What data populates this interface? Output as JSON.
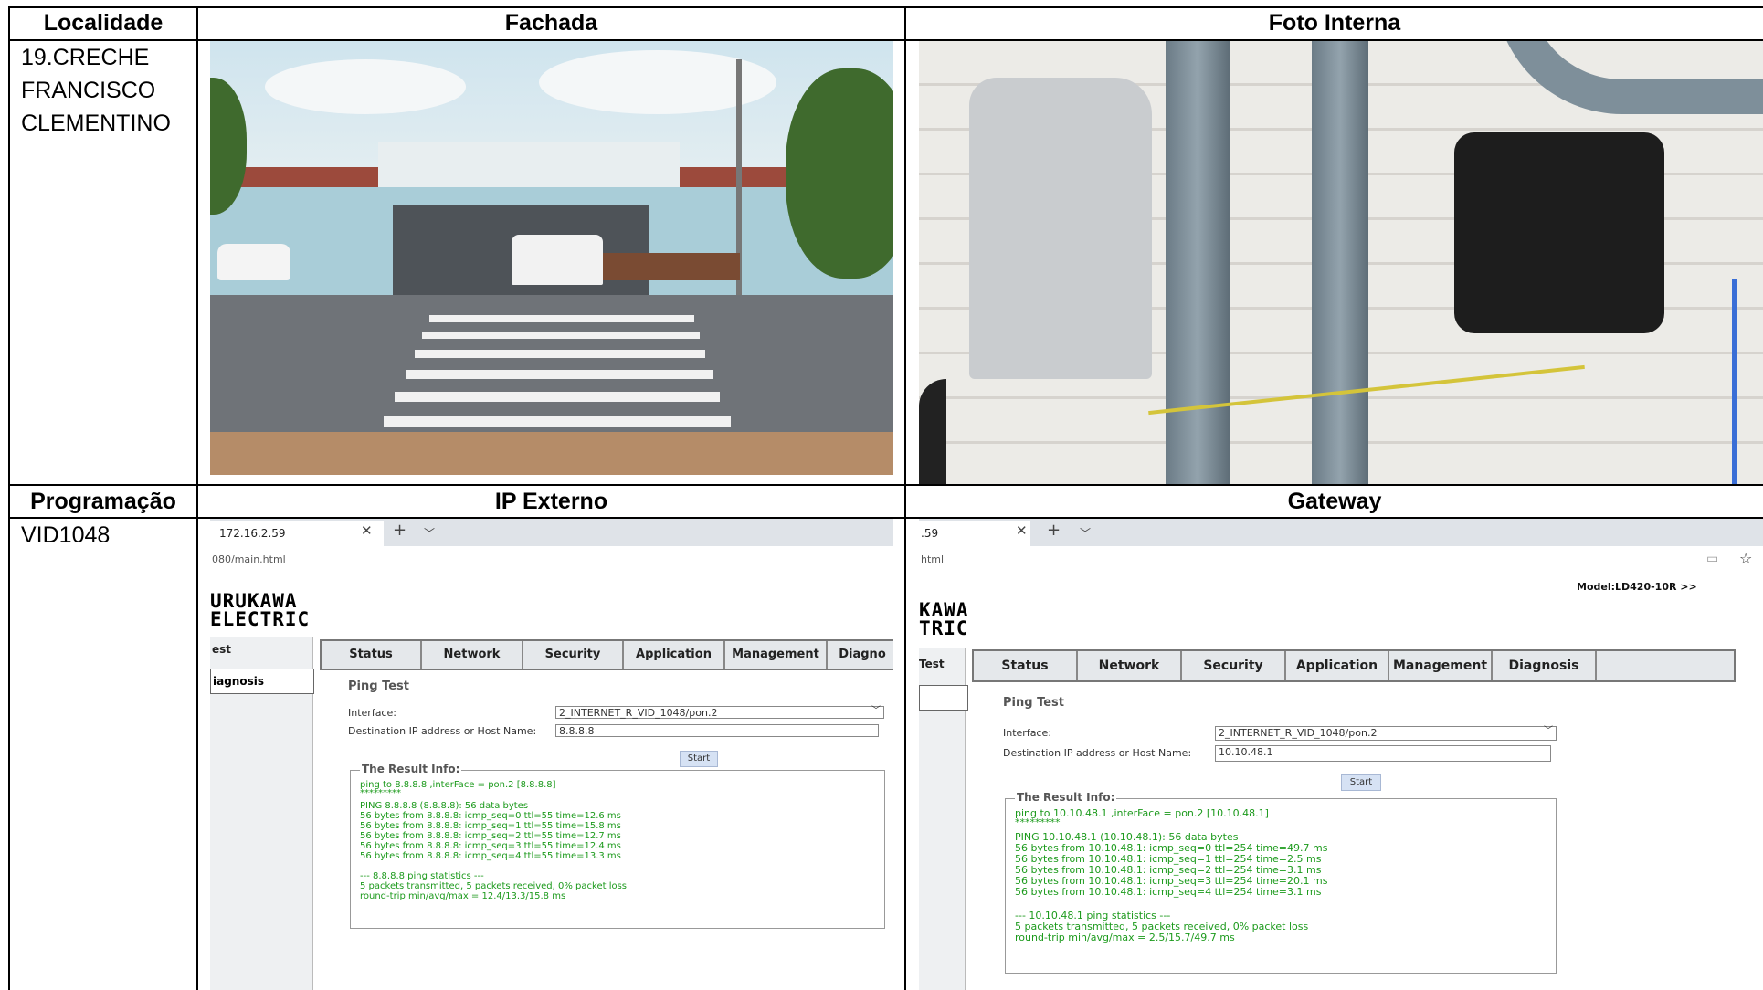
{
  "table": {
    "headers": {
      "localidade": "Localidade",
      "fachada": "Fachada",
      "foto_interna": "Foto Interna",
      "programacao": "Programação",
      "ip_externo": "IP Externo",
      "gateway": "Gateway"
    },
    "localidade_value": [
      "19.CRECHE",
      "FRANCISCO",
      "CLEMENTINO"
    ],
    "programacao_value": "VID1048"
  },
  "ip_externo_shot": {
    "tab_title": "172.16.2.59",
    "url": "080/main.html",
    "logo_line1": "URUKAWA",
    "logo_line2": "ELECTRIC",
    "nav": [
      "est",
      "iagnosis"
    ],
    "menu": [
      "Status",
      "Network",
      "Security",
      "Application",
      "Management",
      "Diagno"
    ],
    "ping_title": "Ping Test",
    "interface_label": "Interface:",
    "interface_value": "2_INTERNET_R_VID_1048/pon.2",
    "dest_label": "Destination IP address or Host Name:",
    "dest_value": "8.8.8.8",
    "start": "Start",
    "result_legend": "The Result Info:",
    "result_lines": [
      "ping to 8.8.8.8 ,interFace = pon.2 [8.8.8.8]",
      "*********",
      "PING 8.8.8.8 (8.8.8.8): 56 data bytes",
      "56 bytes from 8.8.8.8: icmp_seq=0 ttl=55 time=12.6 ms",
      "56 bytes from 8.8.8.8: icmp_seq=1 ttl=55 time=15.8 ms",
      "56 bytes from 8.8.8.8: icmp_seq=2 ttl=55 time=12.7 ms",
      "56 bytes from 8.8.8.8: icmp_seq=3 ttl=55 time=12.4 ms",
      "56 bytes from 8.8.8.8: icmp_seq=4 ttl=55 time=13.3 ms",
      "",
      "--- 8.8.8.8 ping statistics ---",
      "5 packets transmitted, 5 packets received, 0% packet loss",
      "round-trip min/avg/max = 12.4/13.3/15.8 ms"
    ]
  },
  "gateway_shot": {
    "tab_title": ".59",
    "url": "html",
    "logo_line1": "KAWA",
    "logo_line2": "TRIC",
    "model": "Model:LD420-10R  >>",
    "nav": [
      "Test"
    ],
    "menu": [
      "Status",
      "Network",
      "Security",
      "Application",
      "Management",
      "Diagnosis"
    ],
    "ping_title": "Ping Test",
    "interface_label": "Interface:",
    "interface_value": "2_INTERNET_R_VID_1048/pon.2",
    "dest_label": "Destination IP address or Host Name:",
    "dest_value": "10.10.48.1",
    "start": "Start",
    "result_legend": "The Result Info:",
    "result_lines": [
      "ping to 10.10.48.1 ,interFace = pon.2 [10.10.48.1]",
      "*********",
      "PING 10.10.48.1 (10.10.48.1): 56 data bytes",
      "56 bytes from 10.10.48.1: icmp_seq=0 ttl=254 time=49.7 ms",
      "56 bytes from 10.10.48.1: icmp_seq=1 ttl=254 time=2.5 ms",
      "56 bytes from 10.10.48.1: icmp_seq=2 ttl=254 time=3.1 ms",
      "56 bytes from 10.10.48.1: icmp_seq=3 ttl=254 time=20.1 ms",
      "56 bytes from 10.10.48.1: icmp_seq=4 ttl=254 time=3.1 ms",
      "",
      "--- 10.10.48.1 ping statistics ---",
      "5 packets transmitted, 5 packets received, 0% packet loss",
      "round-trip min/avg/max = 2.5/15.7/49.7 ms"
    ]
  }
}
